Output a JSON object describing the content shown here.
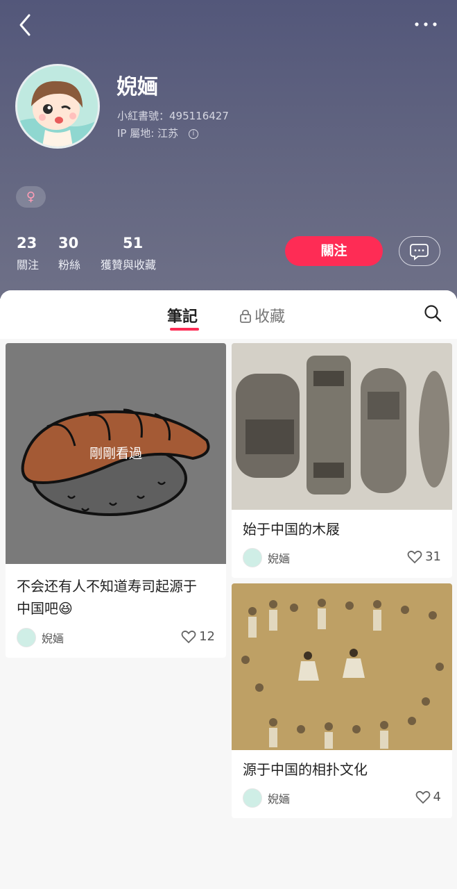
{
  "profile": {
    "name": "婗婳",
    "red_id": "小紅書號：495116427",
    "ip_location": "IP 屬地: 江苏",
    "gender_symbol": "♀"
  },
  "stats": [
    {
      "num": "23",
      "label": "關注"
    },
    {
      "num": "30",
      "label": "粉絲"
    },
    {
      "num": "51",
      "label": "獲贊與收藏"
    }
  ],
  "actions": {
    "follow_label": "關注"
  },
  "tabs": {
    "notes_label": "筆記",
    "collect_label": "收藏"
  },
  "notes": [
    {
      "overlay": "剛剛看過",
      "title_line1": "不会还有人不知道寿司起源于",
      "title_line2": "中国吧😆",
      "author": "婗婳",
      "likes": "12"
    },
    {
      "title": "始于中国的木屐",
      "author": "婗婳",
      "likes": "31"
    },
    {
      "title": "源于中国的相扑文化",
      "author": "婗婳",
      "likes": "4"
    }
  ],
  "colors": {
    "accent": "#fe2c55",
    "header_bg": "#5e6180"
  }
}
